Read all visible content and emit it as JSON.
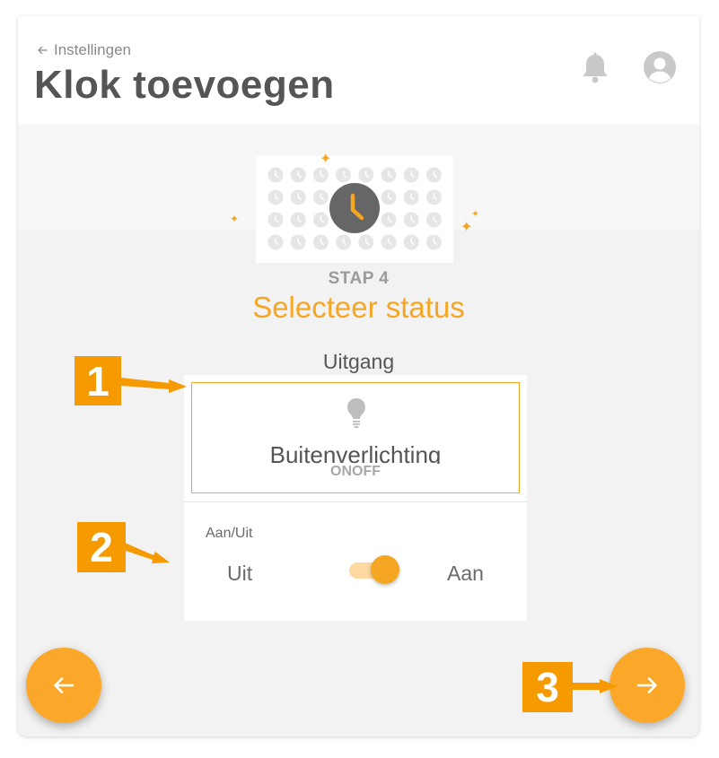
{
  "header": {
    "breadcrumb": "Instellingen",
    "title": "Klok toevoegen"
  },
  "step": {
    "label": "STAP 4",
    "title": "Selecteer status"
  },
  "output": {
    "section_label": "Uitgang",
    "name": "Buitenverlichting",
    "type": "ONOFF"
  },
  "toggle": {
    "label": "Aan/Uit",
    "off_label": "Uit",
    "on_label": "Aan",
    "state": "on"
  },
  "annotations": [
    "1",
    "2",
    "3"
  ],
  "colors": {
    "accent": "#f5a623",
    "fab": "#fba82a",
    "callout": "#f59a00",
    "title_text": "#555555",
    "muted_text": "#9a9a9a"
  },
  "icons": {
    "breadcrumb": "arrow-left-icon",
    "notifications": "bell-icon",
    "profile": "user-icon",
    "output": "lightbulb-icon",
    "back": "arrow-left-icon",
    "next": "arrow-right-icon",
    "illustration": "clock-icon",
    "sparkle": "sparkle-icon"
  }
}
